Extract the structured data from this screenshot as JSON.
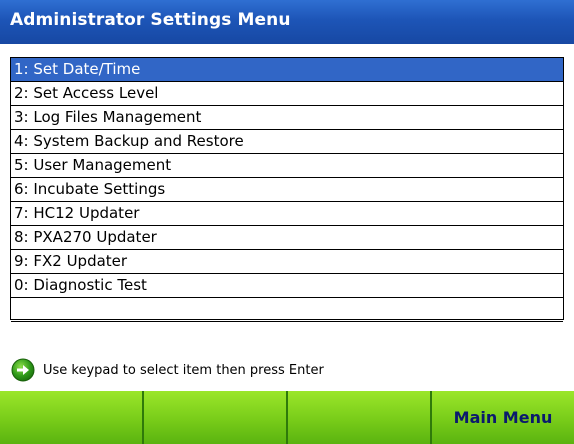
{
  "window": {
    "title": "Administrator Settings Menu"
  },
  "menu": {
    "items": [
      {
        "label": "1: Set Date/Time",
        "selected": true
      },
      {
        "label": "2: Set Access Level"
      },
      {
        "label": "3: Log Files Management"
      },
      {
        "label": "4: System Backup and Restore"
      },
      {
        "label": "5: User Management"
      },
      {
        "label": "6: Incubate Settings"
      },
      {
        "label": "7: HC12 Updater"
      },
      {
        "label": "8: PXA270 Updater"
      },
      {
        "label": "9: FX2 Updater"
      },
      {
        "label": "0: Diagnostic Test"
      },
      {
        "label": ""
      }
    ]
  },
  "hint": {
    "icon": "arrow-right-circle-icon",
    "text": "Use keypad to select item then press Enter"
  },
  "softkeys": [
    {
      "label": ""
    },
    {
      "label": ""
    },
    {
      "label": ""
    },
    {
      "label": "Main Menu"
    }
  ],
  "colors": {
    "title_bar": "#1d55b7",
    "selection": "#3166c6",
    "softkey": "#78cc19",
    "softkey_text": "#0b1a6d"
  }
}
